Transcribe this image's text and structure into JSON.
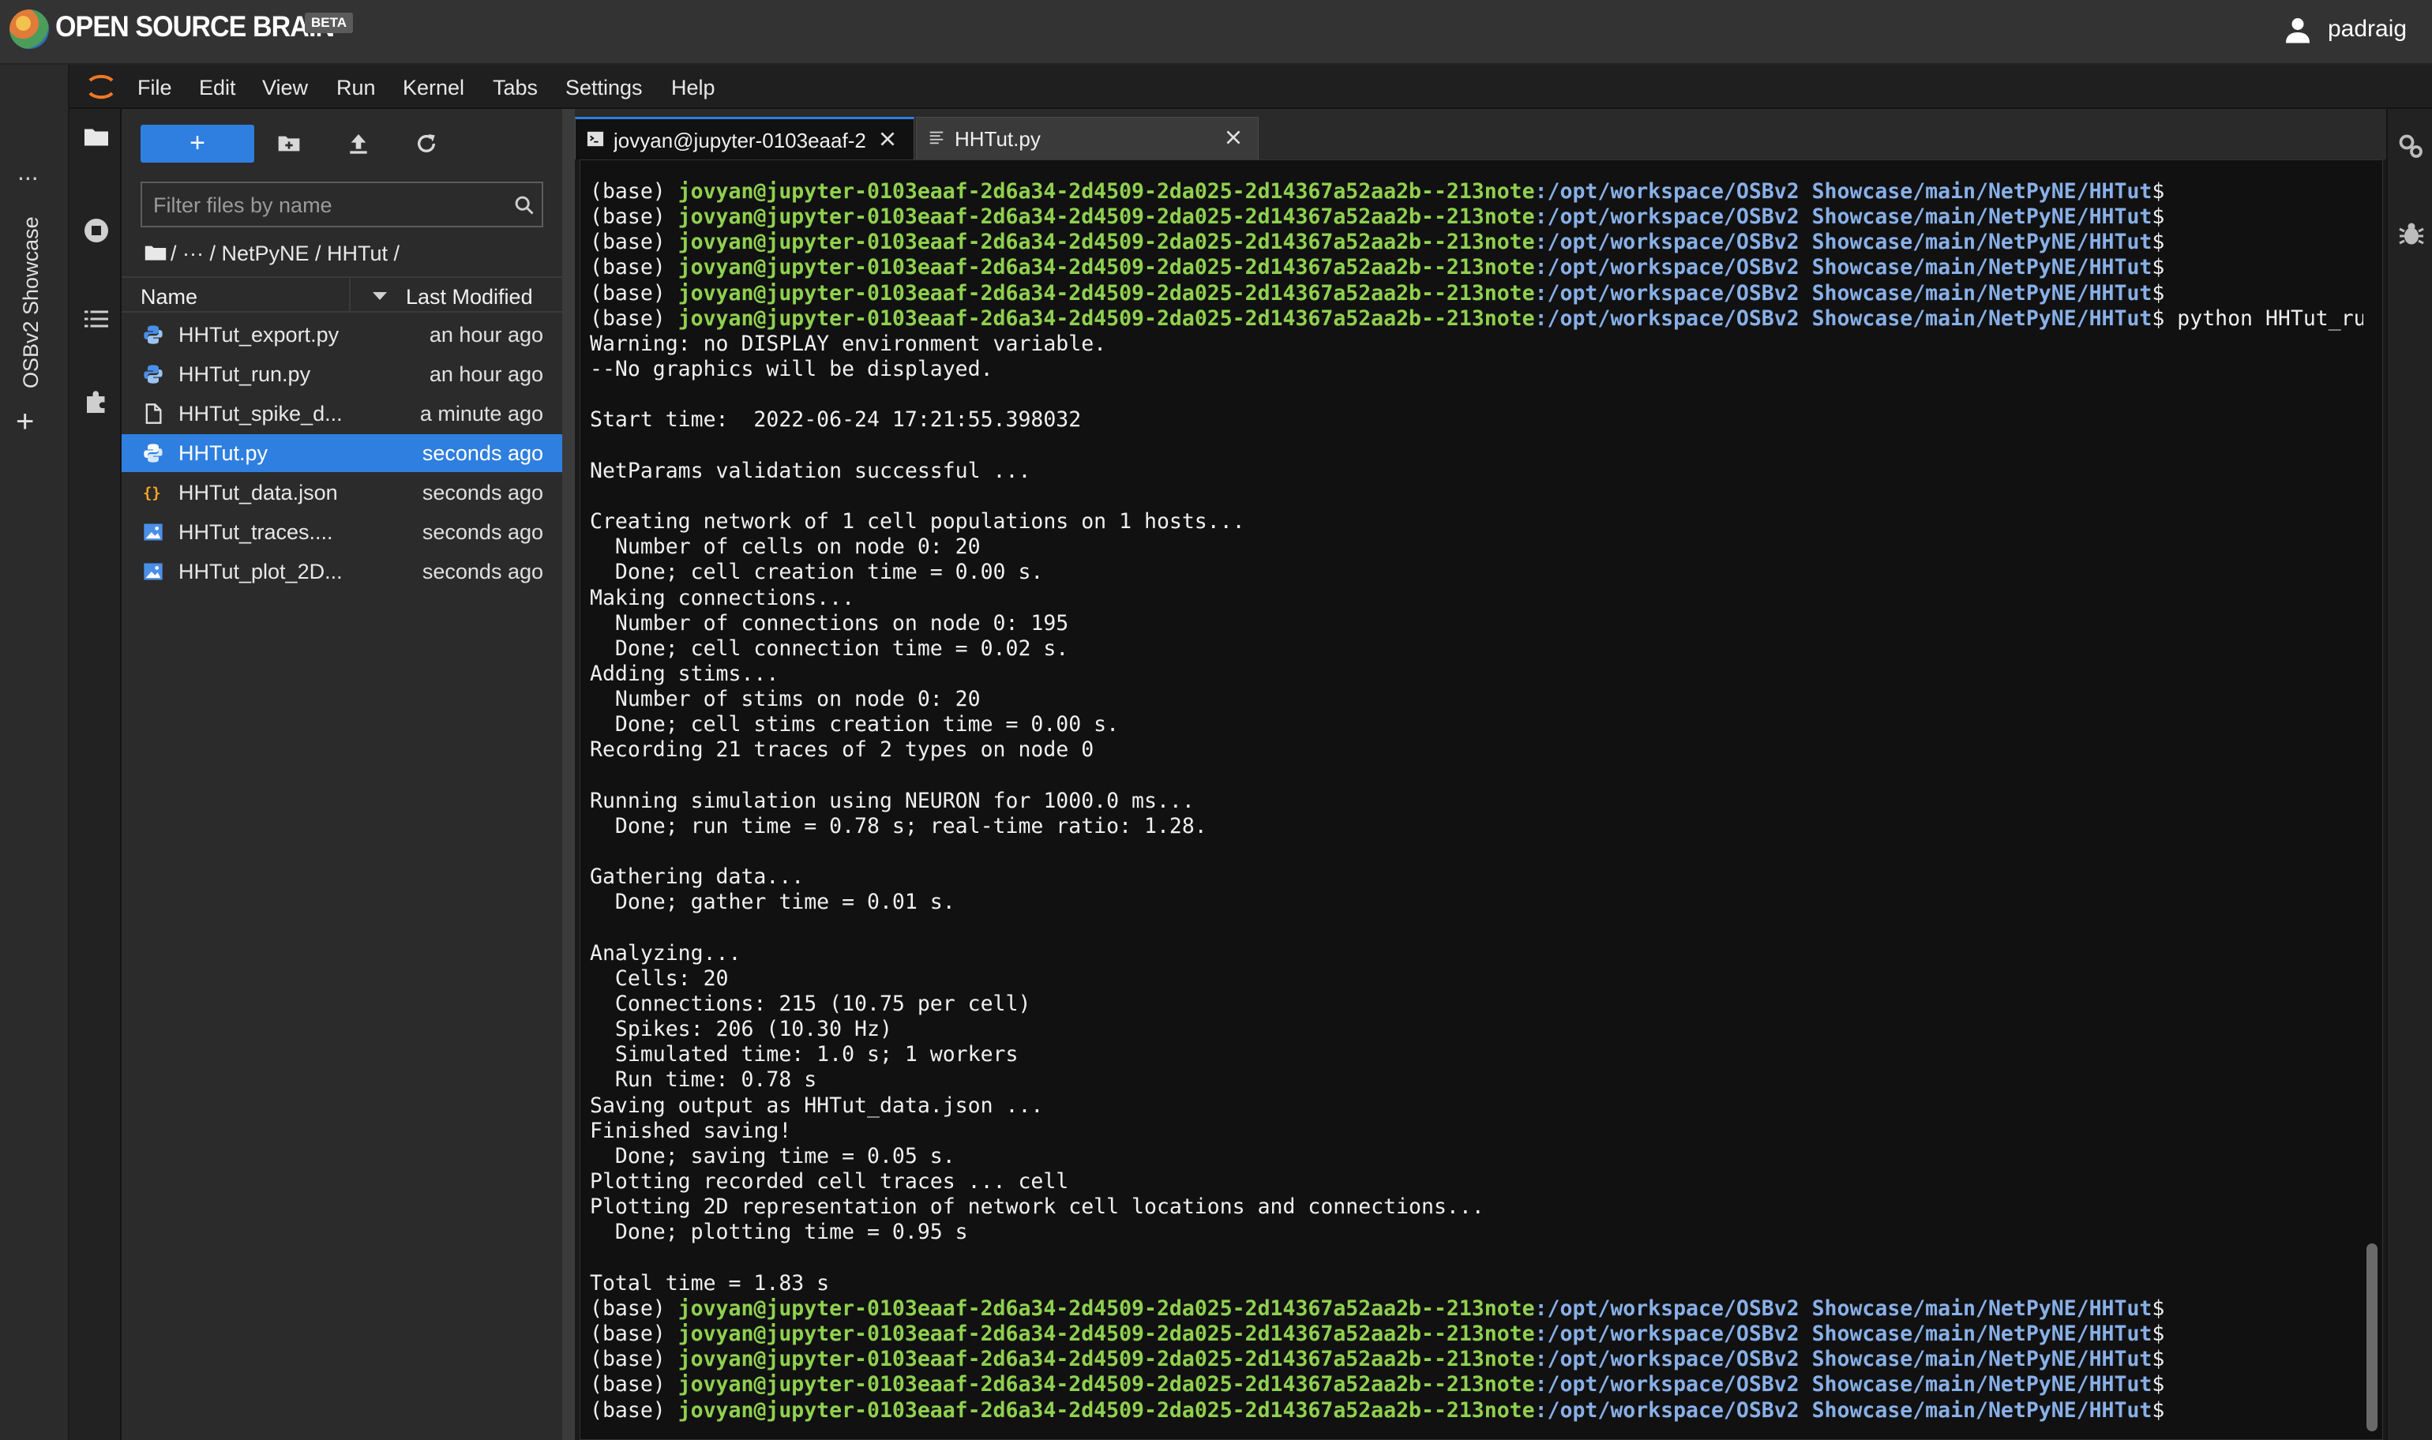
{
  "header": {
    "brand": "OPEN SOURCE BRAIN",
    "beta": "BETA",
    "user": "padraig"
  },
  "strip": {
    "label": "OSBv2 Showcase",
    "dots": "...",
    "plus": "+"
  },
  "menubar": {
    "items": [
      "File",
      "Edit",
      "View",
      "Run",
      "Kernel",
      "Tabs",
      "Settings",
      "Help"
    ]
  },
  "filebrowser": {
    "new_label": "+",
    "filter_placeholder": "Filter files by name",
    "breadcrumb": "/  ···  / NetPyNE / HHTut /",
    "col_name": "Name",
    "col_modified": "Last Modified",
    "files": [
      {
        "name": "HHTut_export.py",
        "modified": "an hour ago",
        "icon": "python-file-icon"
      },
      {
        "name": "HHTut_run.py",
        "modified": "an hour ago",
        "icon": "python-file-icon"
      },
      {
        "name": "HHTut_spike_d...",
        "modified": "a minute ago",
        "icon": "text-file-icon"
      },
      {
        "name": "HHTut.py",
        "modified": "seconds ago",
        "icon": "python-file-icon",
        "selected": true
      },
      {
        "name": "HHTut_data.json",
        "modified": "seconds ago",
        "icon": "json-file-icon"
      },
      {
        "name": "HHTut_traces....",
        "modified": "seconds ago",
        "icon": "image-file-icon"
      },
      {
        "name": "HHTut_plot_2D...",
        "modified": "seconds ago",
        "icon": "image-file-icon"
      }
    ]
  },
  "tabs": [
    {
      "label": "jovyan@jupyter-0103eaaf-2",
      "icon": "terminal-icon",
      "active": true
    },
    {
      "label": "HHTut.py",
      "icon": "text-editor-icon",
      "active": false
    }
  ],
  "terminal": {
    "prompt_base": "(base) ",
    "prompt_user": "jovyan@jupyter-0103eaaf-2d6a34-2d4509-2da025-2d14367a52aa2b--213note",
    "prompt_path": ":/opt/workspace/OSBv2 Showcase/main/NetPyNE/HHTut",
    "prompt_end": "$",
    "lines": [
      {
        "type": "prompt",
        "cmd": ""
      },
      {
        "type": "prompt",
        "cmd": ""
      },
      {
        "type": "prompt",
        "cmd": ""
      },
      {
        "type": "prompt",
        "cmd": ""
      },
      {
        "type": "prompt",
        "cmd": ""
      },
      {
        "type": "prompt",
        "cmd": " python HHTut_run.py"
      },
      {
        "type": "text",
        "text": "Warning: no DISPLAY environment variable."
      },
      {
        "type": "text",
        "text": "--No graphics will be displayed."
      },
      {
        "type": "text",
        "text": ""
      },
      {
        "type": "text",
        "text": "Start time:  2022-06-24 17:21:55.398032"
      },
      {
        "type": "text",
        "text": ""
      },
      {
        "type": "text",
        "text": "NetParams validation successful ..."
      },
      {
        "type": "text",
        "text": ""
      },
      {
        "type": "text",
        "text": "Creating network of 1 cell populations on 1 hosts..."
      },
      {
        "type": "text",
        "text": "  Number of cells on node 0: 20"
      },
      {
        "type": "text",
        "text": "  Done; cell creation time = 0.00 s."
      },
      {
        "type": "text",
        "text": "Making connections..."
      },
      {
        "type": "text",
        "text": "  Number of connections on node 0: 195"
      },
      {
        "type": "text",
        "text": "  Done; cell connection time = 0.02 s."
      },
      {
        "type": "text",
        "text": "Adding stims..."
      },
      {
        "type": "text",
        "text": "  Number of stims on node 0: 20"
      },
      {
        "type": "text",
        "text": "  Done; cell stims creation time = 0.00 s."
      },
      {
        "type": "text",
        "text": "Recording 21 traces of 2 types on node 0"
      },
      {
        "type": "text",
        "text": ""
      },
      {
        "type": "text",
        "text": "Running simulation using NEURON for 1000.0 ms..."
      },
      {
        "type": "text",
        "text": "  Done; run time = 0.78 s; real-time ratio: 1.28."
      },
      {
        "type": "text",
        "text": ""
      },
      {
        "type": "text",
        "text": "Gathering data..."
      },
      {
        "type": "text",
        "text": "  Done; gather time = 0.01 s."
      },
      {
        "type": "text",
        "text": ""
      },
      {
        "type": "text",
        "text": "Analyzing..."
      },
      {
        "type": "text",
        "text": "  Cells: 20"
      },
      {
        "type": "text",
        "text": "  Connections: 215 (10.75 per cell)"
      },
      {
        "type": "text",
        "text": "  Spikes: 206 (10.30 Hz)"
      },
      {
        "type": "text",
        "text": "  Simulated time: 1.0 s; 1 workers"
      },
      {
        "type": "text",
        "text": "  Run time: 0.78 s"
      },
      {
        "type": "text",
        "text": "Saving output as HHTut_data.json ..."
      },
      {
        "type": "text",
        "text": "Finished saving!"
      },
      {
        "type": "text",
        "text": "  Done; saving time = 0.05 s."
      },
      {
        "type": "text",
        "text": "Plotting recorded cell traces ... cell"
      },
      {
        "type": "text",
        "text": "Plotting 2D representation of network cell locations and connections..."
      },
      {
        "type": "text",
        "text": "  Done; plotting time = 0.95 s"
      },
      {
        "type": "text",
        "text": ""
      },
      {
        "type": "text",
        "text": "Total time = 1.83 s"
      },
      {
        "type": "prompt",
        "cmd": ""
      },
      {
        "type": "prompt",
        "cmd": ""
      },
      {
        "type": "prompt",
        "cmd": ""
      },
      {
        "type": "prompt",
        "cmd": ""
      },
      {
        "type": "prompt",
        "cmd": ""
      }
    ]
  },
  "colors": {
    "accent": "#2e7fe0",
    "prompt_user": "#8fd14f",
    "prompt_path": "#88b0e8"
  }
}
